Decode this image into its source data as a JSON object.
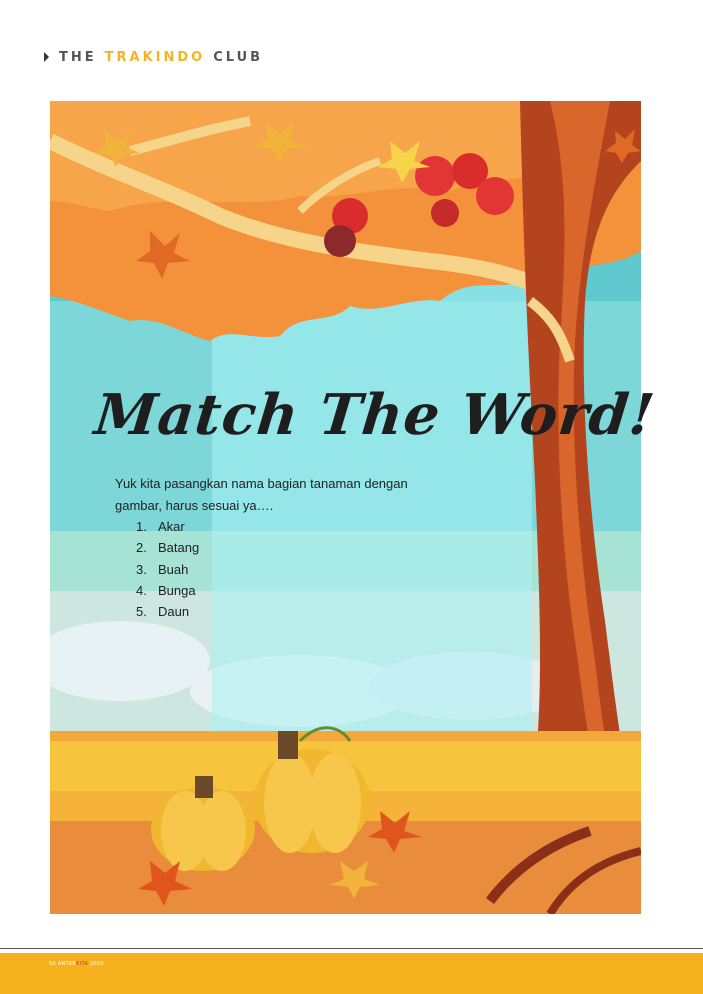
{
  "header": {
    "word1": "THE",
    "word2": "TRAKINDO",
    "word3": "CLUB",
    "accent": "#f5b323"
  },
  "title": "Match The Word!",
  "intro": "Yuk kita pasangkan nama bagian tanaman dengan gambar, harus sesuai ya….",
  "items": [
    {
      "num": "1.",
      "label": "Akar"
    },
    {
      "num": "2.",
      "label": "Batang"
    },
    {
      "num": "3.",
      "label": "Buah"
    },
    {
      "num": "4.",
      "label": "Bunga"
    },
    {
      "num": "5.",
      "label": "Daun"
    }
  ],
  "footer": {
    "page": "56",
    "mag1": "ANTAR",
    "mag2": "KITA",
    "year": "2020",
    "color": "#f5b21c"
  }
}
